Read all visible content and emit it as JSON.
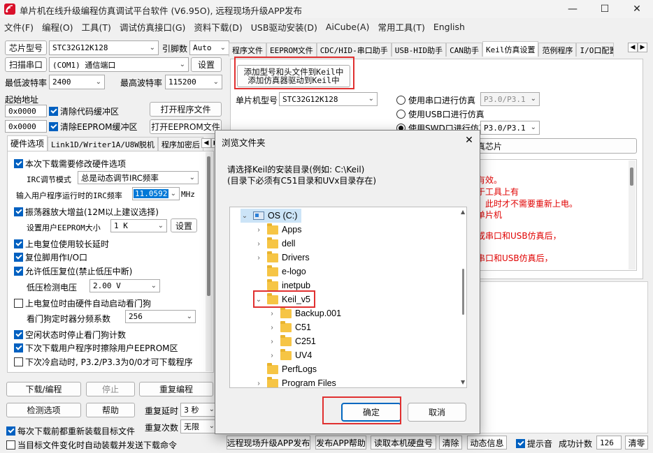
{
  "window": {
    "title": "单片机在线升级编程仿真调试平台软件 (V6.95O), 远程现场升级APP发布",
    "minimize_glyph": "—",
    "maximize_glyph": "☐",
    "close_glyph": "✕"
  },
  "menu": [
    "文件(F)",
    "编程(O)",
    "工具(T)",
    "调试仿真接口(G)",
    "资料下载(D)",
    "USB驱动安装(D)",
    "AiCube(A)",
    "常用工具(T)",
    "English"
  ],
  "left": {
    "chip_label": "芯片型号",
    "chip_value": "STC32G12K128",
    "pins_label": "引脚数",
    "pins_value": "Auto",
    "scan_label": "扫描串口",
    "port_value": "(COM1) 通信端口",
    "settings_label": "设置",
    "min_baud_label": "最低波特率",
    "min_baud_value": "2400",
    "max_baud_label": "最高波特率",
    "max_baud_value": "115200",
    "start_addr_label": "起始地址",
    "code_addr": "0x0000",
    "clear_code_label": "清除代码缓冲区",
    "open_program_label": "打开程序文件",
    "eeprom_addr": "0x0000",
    "clear_eeprom_label": "清除EEPROM缓冲区",
    "open_eeprom_label": "打开EEPROM文件",
    "tabs": [
      "硬件选项",
      "Link1D/Writer1A/U8W脱机",
      "程序加密后"
    ],
    "hw": {
      "modify_hw": "本次下载需要修改硬件选项",
      "irc_mode_label": "IRC调节模式",
      "irc_mode_value": "总是动态调节IRC频率",
      "irc_freq_label": "输入用户程序运行时的IRC频率",
      "irc_freq_value": "11.0592",
      "irc_freq_unit": "MHz",
      "osc_gain": "振荡器放大增益(12M以上建议选择)",
      "eeprom_size_label": "设置用户EEPROM大小",
      "eeprom_size_value": "1  K",
      "eeprom_set": "设置",
      "long_delay": "上电复位使用较长延时",
      "reset_io": "复位脚用作I/O口",
      "lvd_reset": "允许低压复位(禁止低压中断)",
      "lvd_label": "低压检测电压",
      "lvd_value": "2.00 V",
      "wdt_auto": "上电复位时由硬件自动启动看门狗",
      "wdt_div_label": "看门狗定时器分频系数",
      "wdt_div_value": "256",
      "idle_wdt": "空闲状态时停止看门狗计数",
      "erase_eeprom": "下次下载用户程序时擦除用户EEPROM区",
      "p32_cold": "下次冷启动时, P3.2/P3.3为0/0才可下载程序"
    },
    "download_label": "下载/编程",
    "stop_label": "停止",
    "reprogram_label": "重复编程",
    "check_label": "检测选项",
    "help_label": "帮助",
    "repeat_delay_label": "重复延时",
    "repeat_delay_value": "3 秒",
    "repeat_count_label": "重复次数",
    "repeat_count_value": "无限",
    "reload_label": "每次下载前都重新装载目标文件",
    "auto_send_label": "当目标文件变化时自动装载并发送下载命令"
  },
  "right": {
    "tabs": [
      "程序文件",
      "EEPROM文件",
      "CDC/HID-串口助手",
      "USB-HID助手",
      "CAN助手",
      "Keil仿真设置",
      "范例程序",
      "I/O口配置"
    ],
    "add_keil_line1": "添加型号和头文件到Keil中",
    "add_keil_line2": "添加仿真器驱动到Keil中",
    "mcu_label": "单片机型号",
    "mcu_value": "STC32G12K128",
    "serial_sim": "使用串口进行仿真",
    "usb_sim": "使用USB口进行仿真",
    "swd_sim": "使用SWD口进行仿真",
    "sim_port_1": "P3.0/P3.1",
    "sim_port_2": "P3.0/P3.1",
    "sim_port_3": "P3.0/P3.1",
    "chip_btn_tail": "真芯片",
    "notes": [
      "有效。",
      "于工具上有",
      "，此时才不需要重新上电。",
      "单片机",
      "或串口和USB仿真后，",
      "串口和USB仿真后，"
    ]
  },
  "dialog": {
    "title": "浏览文件夹",
    "close_glyph": "✕",
    "prompt_line1": "请选择Keil的安装目录(例如: C:\\Keil)",
    "prompt_line2": "(目录下必须有C51目录和UVx目录存在)",
    "tree": [
      {
        "label": "OS (C:)",
        "kind": "drive",
        "exp": "⌄"
      },
      {
        "label": "Apps",
        "kind": "folder",
        "exp": "›"
      },
      {
        "label": "dell",
        "kind": "folder",
        "exp": "›"
      },
      {
        "label": "Drivers",
        "kind": "folder",
        "exp": "›"
      },
      {
        "label": "e-logo",
        "kind": "folder",
        "exp": ""
      },
      {
        "label": "inetpub",
        "kind": "folder",
        "exp": ""
      },
      {
        "label": "Keil_v5",
        "kind": "folder",
        "exp": "⌄"
      },
      {
        "label": "Backup.001",
        "kind": "folder",
        "exp": "›"
      },
      {
        "label": "C51",
        "kind": "folder",
        "exp": "›"
      },
      {
        "label": "C251",
        "kind": "folder",
        "exp": "›"
      },
      {
        "label": "UV4",
        "kind": "folder",
        "exp": "›"
      },
      {
        "label": "PerfLogs",
        "kind": "folder",
        "exp": ""
      },
      {
        "label": "Program Files",
        "kind": "folder",
        "exp": "›"
      }
    ],
    "ok_label": "确定",
    "cancel_label": "取消"
  },
  "status": {
    "remote_upgrade": "远程现场升级APP发布",
    "app_help": "发布APP帮助",
    "read_disk": "读取本机硬盘号",
    "clear": "清除",
    "anim": "动态信息",
    "beep": "提示音",
    "success_label": "成功计数",
    "success_value": "126",
    "reset_count": "清零"
  },
  "colors": {
    "highlight": "#e03030",
    "checked": "#0060c0",
    "note_text": "#e00000",
    "folder": "#f6c545"
  }
}
